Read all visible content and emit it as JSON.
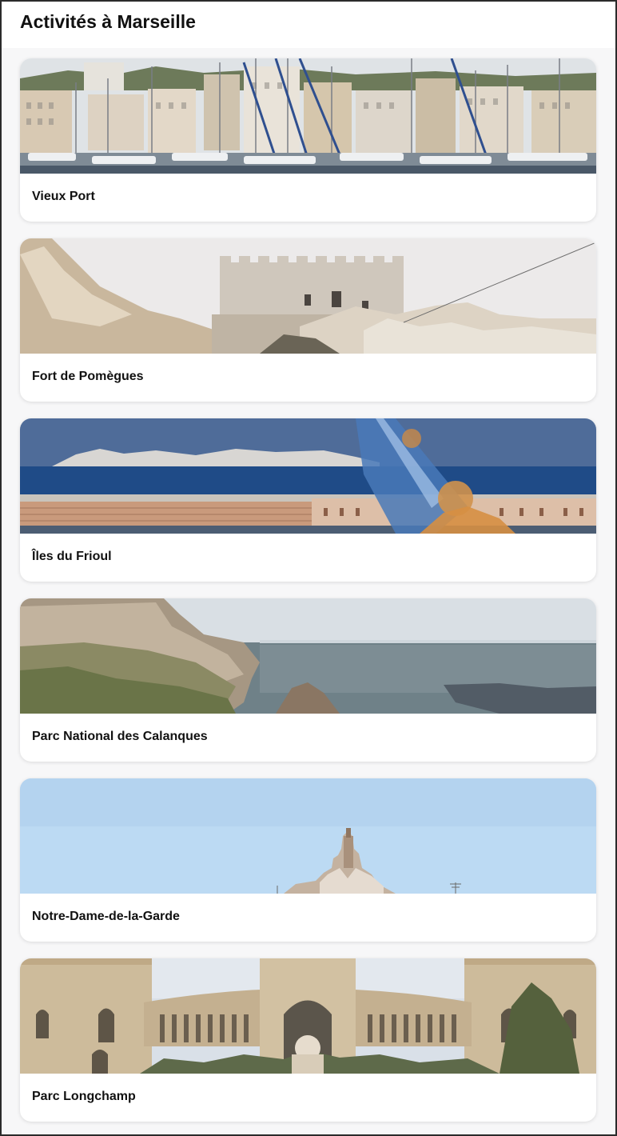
{
  "header": {
    "title": "Activités à Marseille"
  },
  "activities": [
    {
      "name": "Vieux Port",
      "image": "vieux-port-photo"
    },
    {
      "name": "Fort de Pomègues",
      "image": "fort-pomegues-photo"
    },
    {
      "name": "Îles du Frioul",
      "image": "iles-frioul-photo"
    },
    {
      "name": "Parc National des Calanques",
      "image": "calanques-photo"
    },
    {
      "name": "Notre-Dame-de-la-Garde",
      "image": "notre-dame-photo"
    },
    {
      "name": "Parc Longchamp",
      "image": "parc-longchamp-photo"
    }
  ]
}
